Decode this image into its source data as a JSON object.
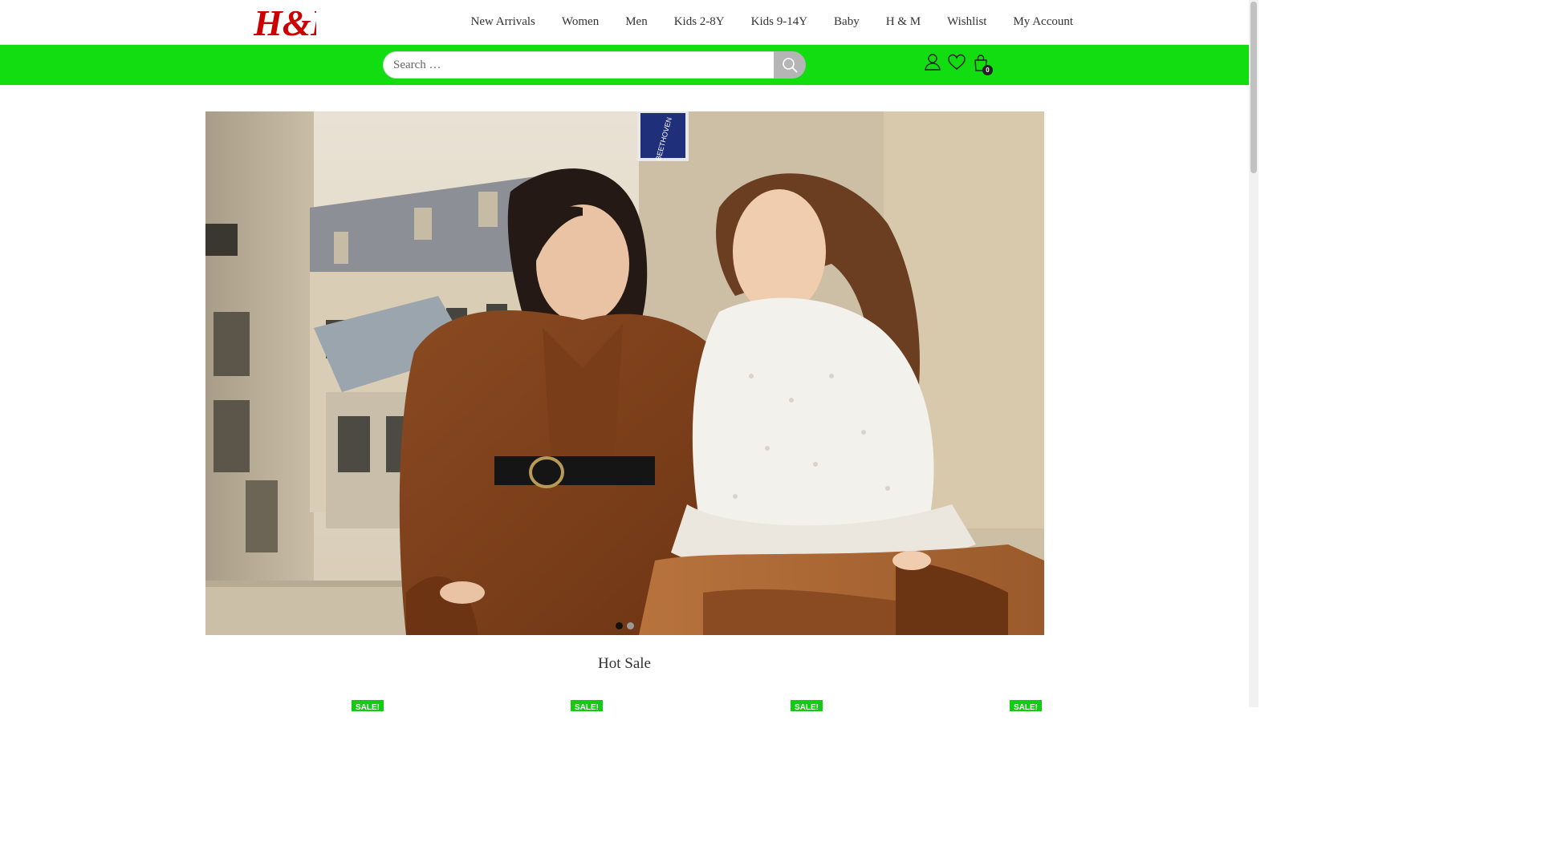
{
  "brand": {
    "logo_text": "H&M",
    "color": "#cc0000"
  },
  "nav": {
    "items": [
      "New Arrivals",
      "Women",
      "Men",
      "Kids 2-8Y",
      "Kids 9-14Y",
      "Baby",
      "H & M",
      "Wishlist",
      "My Account"
    ]
  },
  "search": {
    "placeholder": "Search …"
  },
  "header_icons": {
    "account": "user-icon",
    "wishlist": "heart-icon",
    "cart": "shopping-bag-icon",
    "cart_count": "0"
  },
  "colors": {
    "accent_green": "#11dd11",
    "badge_green": "#11cc11"
  },
  "hero": {
    "sign_text": "BEETHOVEN",
    "slides": 2,
    "active_slide": 1
  },
  "hot_sale": {
    "title": "Hot Sale"
  },
  "products": [
    {
      "badge": "SALE!"
    },
    {
      "badge": "SALE!"
    },
    {
      "badge": "SALE!"
    },
    {
      "badge": "SALE!"
    }
  ]
}
